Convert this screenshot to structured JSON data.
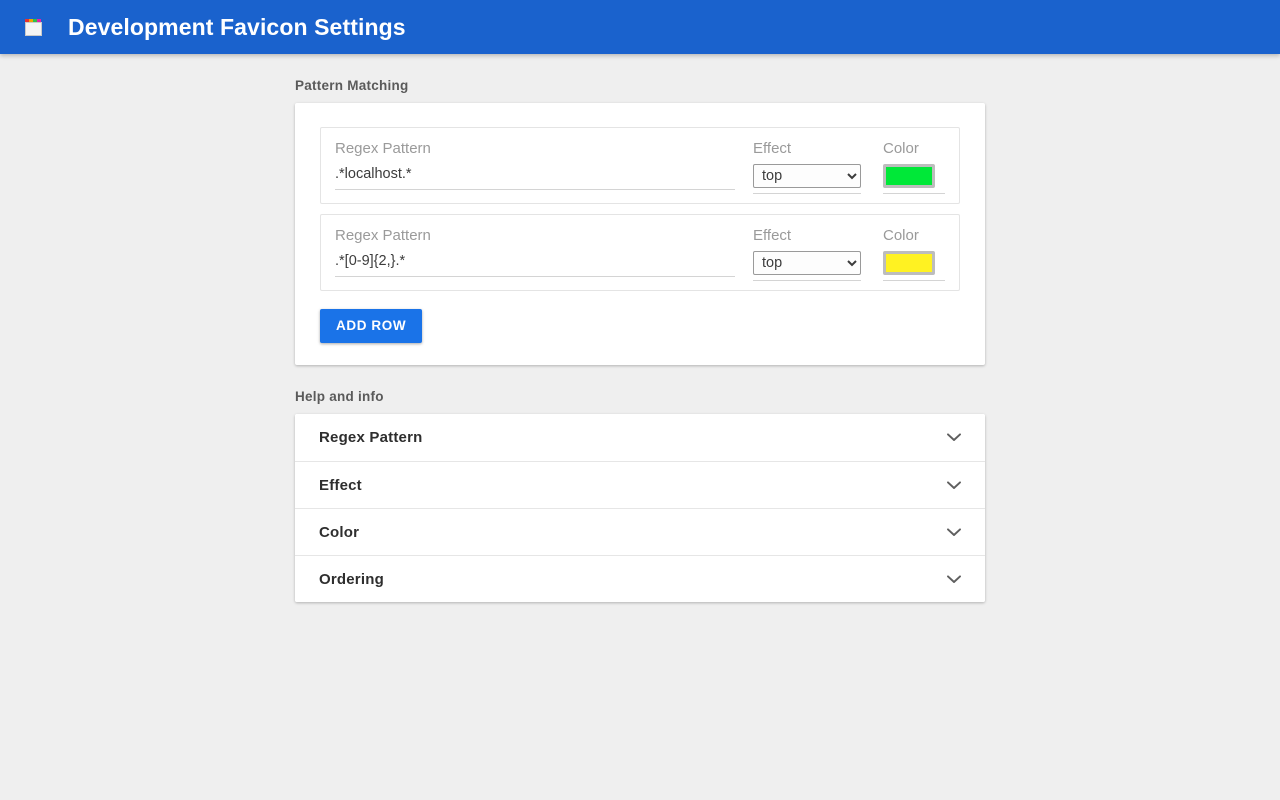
{
  "appbar": {
    "icon": "favicon-palette-icon",
    "title": "Development Favicon Settings",
    "background": "#1a62cd"
  },
  "pattern_matching": {
    "section_title": "Pattern Matching",
    "column_labels": {
      "pattern": "Regex Pattern",
      "effect": "Effect",
      "color": "Color"
    },
    "rows": [
      {
        "pattern_label": "Regex Pattern",
        "pattern_value": ".*localhost.*",
        "pattern_placeholder": "Regex Pattern",
        "effect_label": "Effect",
        "effect_value": "top",
        "color_label": "Color",
        "color_value": "#00e838"
      },
      {
        "pattern_label": "Regex Pattern",
        "pattern_value": ".*[0-9]{2,}.*",
        "pattern_placeholder": "Regex Pattern",
        "effect_label": "Effect",
        "effect_value": "top",
        "color_label": "Color",
        "color_value": "#fff222"
      }
    ],
    "effect_options": [
      "top"
    ],
    "add_row_label": "ADD ROW",
    "add_row_color": "#1a73e8"
  },
  "help": {
    "section_title": "Help and info",
    "panels": [
      {
        "title": "Regex Pattern",
        "icon": "chevron-down-icon"
      },
      {
        "title": "Effect",
        "icon": "chevron-down-icon"
      },
      {
        "title": "Color",
        "icon": "chevron-down-icon"
      },
      {
        "title": "Ordering",
        "icon": "chevron-down-icon"
      }
    ]
  }
}
